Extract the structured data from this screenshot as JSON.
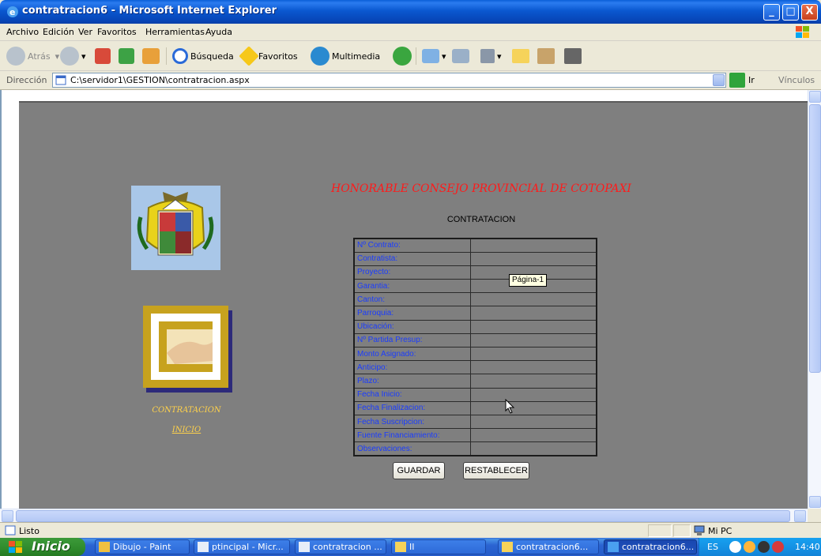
{
  "window": {
    "title": "contratracion6 - Microsoft Internet Explorer",
    "controls": [
      "_",
      "□",
      "X"
    ]
  },
  "menu": {
    "items": [
      "Archivo",
      "Edición",
      "Ver",
      "Favoritos",
      "Herramientas",
      "Ayuda"
    ]
  },
  "toolbar": {
    "back": "Atrás",
    "search": "Búsqueda",
    "favorites": "Favoritos",
    "multimedia": "Multimedia"
  },
  "address": {
    "label": "Dirección",
    "value": "C:\\servidor1\\GESTION\\contratracion.aspx",
    "go": "Ir",
    "links": "Vínculos"
  },
  "page": {
    "heading": "HONORABLE CONSEJO PROVINCIAL DE COTOPAXI",
    "subheading": "CONTRATACION",
    "nav": {
      "contratacion": "CONTRATACION",
      "inicio": "INICIO"
    },
    "form_labels": [
      "Nº Contrato:",
      "Contratista:",
      "Proyecto:",
      "Garantia:",
      "Canton:",
      "Parroquia:",
      "Ubicación:",
      "Nº Partida Presup:",
      "Monto Asignado:",
      "Anticipo:",
      "Plazo:",
      "Fecha Inicio:",
      "Fecha Finalizacion:",
      "Fecha Suscripcion:",
      "Fuente Financiamiento:",
      "Observaciones:"
    ],
    "buttons": {
      "save": "GUARDAR",
      "reset": "RESTABLECER"
    },
    "tooltip": "Página-1"
  },
  "status": {
    "text": "Listo",
    "zone": "Mi PC"
  },
  "taskbar": {
    "start": "Inicio",
    "tasks": [
      "Dibujo - Paint",
      "ptincipal - Micr...",
      "contratracion ...",
      "II",
      "contratracion6...",
      "contratracion6..."
    ],
    "language": "ES",
    "clock": "14:40"
  },
  "colors": {
    "page_background": "#7f7f7f",
    "heading": "#ff1a1a",
    "form_label": "#1a3cff",
    "nav_link": "#ffd24a"
  }
}
